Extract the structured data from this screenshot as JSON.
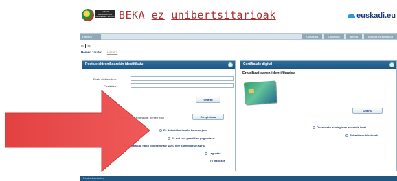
{
  "header": {
    "logo_lines": [
      "EUSKO JAURLARITZA",
      "GOBIERNO VASCO"
    ],
    "title_prefix": "BEKA",
    "title_ez": "ez",
    "title_rest": "unibertsitarioak",
    "brand": "euskadi.eu"
  },
  "nav": {
    "home": "Hasiera",
    "links": [
      "Kontaktua",
      "Laguntza",
      "Bekoa",
      "Egoitza elektronikoa"
    ]
  },
  "lang": {
    "eu": "eu",
    "es": "es"
  },
  "breadcrumb": {
    "label": "Hemen zaude:",
    "current": "Hasiera"
  },
  "left_panel": {
    "title": "Posta elektronikoarekin identifikatu",
    "email_label": "Posta elektronikoa:",
    "password_label": "Pasahitza:",
    "login_button": "Onartu",
    "register_text": "Erregistratuta ez bazaude, hemen egin",
    "register_button": "Erregistratu",
    "links": [
      "Ez dut aktibaziorako korreoa jaso",
      "Ez dut nire pasahitza gogoratzen",
      "Erregistratuta nago edo ezin naiz sartu nire korreoarekin sartu",
      "Laguntza",
      "Itzultzea"
    ]
  },
  "right_panel": {
    "title": "Certificado digital",
    "subtitle": "Erabiltzailearen identifikazioa",
    "accept_button": "Onartu",
    "links": [
      "Onartutako ziurtagirien zerrenda ikusi",
      "Beharkizun teknikoak"
    ]
  },
  "footer": {
    "text": "Eusko Jaurlaritza"
  },
  "colors": {
    "header_blue": "#1f5682",
    "title_red": "#b03030",
    "arrow_red": "#e53a3a"
  }
}
